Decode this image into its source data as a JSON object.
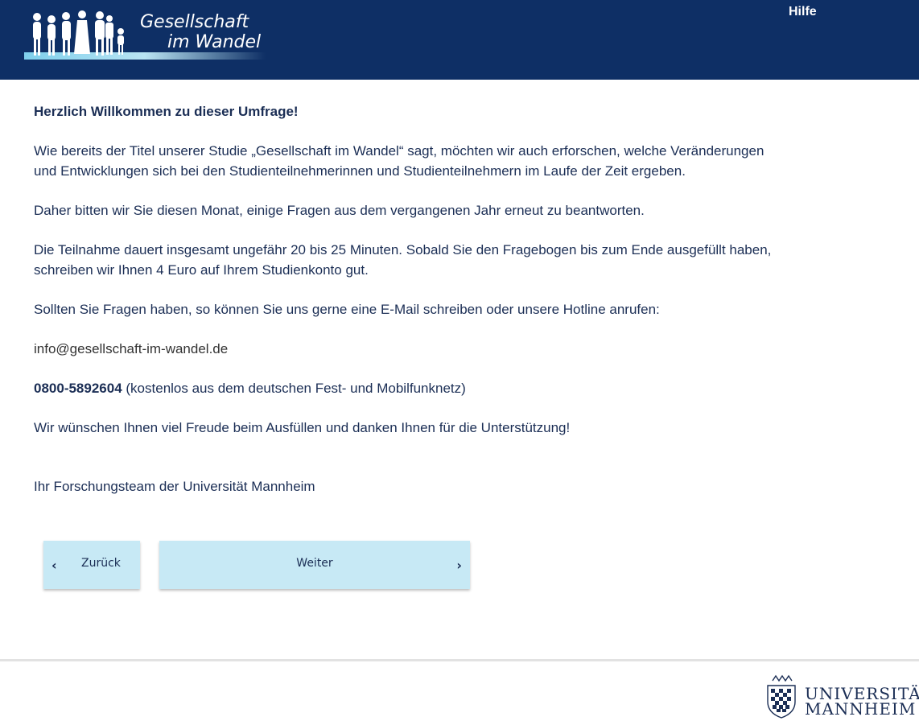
{
  "header": {
    "logo_line1": "Gesellschaft",
    "logo_line2": "im Wandel",
    "help_label": "Hilfe"
  },
  "content": {
    "welcome": "Herzlich Willkommen zu dieser Umfrage!",
    "paragraph1_line1": "Wie bereits der Titel unserer Studie „Gesellschaft im Wandel“ sagt, möchten wir auch erforschen, welche Veränderungen",
    "paragraph1_line2": "und Entwicklungen sich bei den Studienteilnehmerinnen und Studienteilnehmern im Laufe der Zeit ergeben.",
    "paragraph2": "Daher bitten wir Sie diesen Monat, einige Fragen aus dem vergangenen Jahr erneut zu beantworten.",
    "paragraph3_line1": "Die Teilnahme dauert insgesamt ungefähr 20 bis 25 Minuten. Sobald Sie den Fragebogen bis zum Ende ausgefüllt haben,",
    "paragraph3_line2": "schreiben wir Ihnen 4 Euro auf Ihrem Studienkonto gut.",
    "paragraph4": "Sollten Sie Fragen haben, so können Sie uns gerne eine E-Mail schreiben oder unsere Hotline anrufen:",
    "email": "info@gesellschaft-im-wandel.de",
    "phone": "0800-5892604",
    "phone_note": " (kostenlos aus dem deutschen Fest- und Mobilfunknetz)",
    "closing": "Wir wünschen Ihnen viel Freude beim Ausfüllen und danken Ihnen für die Unterstützung!",
    "signature": "Ihr Forschungsteam der Universität Mannheim"
  },
  "nav": {
    "back_label": "Zurück",
    "next_label": "Weiter",
    "back_icon": "chevron-left-icon",
    "next_icon": "chevron-right-icon"
  },
  "footer": {
    "university_line1": "UNIVERSITÄT",
    "university_line2": "MANNHEIM"
  },
  "colors": {
    "header_bg": "#0e2f65",
    "text": "#1b2e55",
    "button_bg": "#c7e9f5"
  }
}
